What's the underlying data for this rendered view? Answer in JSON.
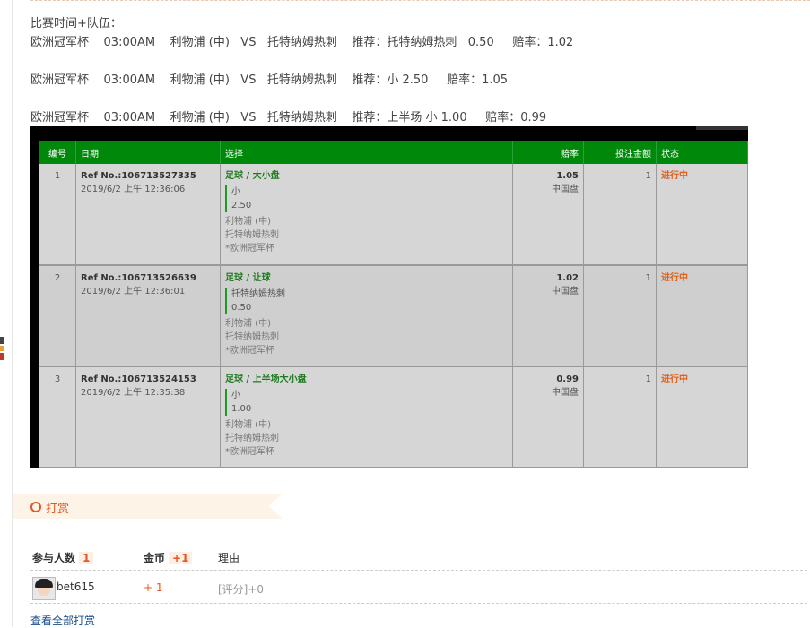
{
  "post": {
    "heading": "比赛时间+队伍：",
    "lines": [
      "欧洲冠军杯    03:00AM    利物浦 (中)   VS   托特纳姆热刺    推荐：托特纳姆热刺   0.50     赔率：1.02",
      "欧洲冠军杯    03:00AM    利物浦 (中)   VS   托特纳姆热刺    推荐：小 2.50     赔率：1.05",
      "欧洲冠军杯    03:00AM    利物浦 (中)   VS   托特纳姆热刺    推荐：上半场 小 1.00     赔率：0.99"
    ]
  },
  "bet_table": {
    "headers": {
      "no": "编号",
      "date": "日期",
      "selection": "选择",
      "odds": "赔率",
      "amount": "投注金额",
      "status": "状态"
    },
    "rows": [
      {
        "no": "1",
        "ref": "Ref No.:106713527335",
        "datetime": "2019/6/2 上午 12:36:06",
        "type": "足球 / 大小盘",
        "pick": "小",
        "line": "2.50",
        "home": "利物浦 (中)",
        "away": "托特纳姆热刺",
        "league": "*欧洲冠军杯",
        "odds": "1.05",
        "odds_type": "中国盘",
        "amount": "1",
        "status": "进行中"
      },
      {
        "no": "2",
        "ref": "Ref No.:106713526639",
        "datetime": "2019/6/2 上午 12:36:01",
        "type": "足球 / 让球",
        "pick": "托特纳姆热刺",
        "line": "0.50",
        "home": "利物浦 (中)",
        "away": "托特纳姆热刺",
        "league": "*欧洲冠军杯",
        "odds": "1.02",
        "odds_type": "中国盘",
        "amount": "1",
        "status": "进行中"
      },
      {
        "no": "3",
        "ref": "Ref No.:106713524153",
        "datetime": "2019/6/2 上午 12:35:38",
        "type": "足球 / 上半场大小盘",
        "pick": "小",
        "line": "1.00",
        "home": "利物浦 (中)",
        "away": "托特纳姆热刺",
        "league": "*欧洲冠军杯",
        "odds": "0.99",
        "odds_type": "中国盘",
        "amount": "1",
        "status": "进行中"
      }
    ]
  },
  "reward": {
    "title": "打赏",
    "participants_label": "参与人数",
    "participants_count": "1",
    "coins_label": "金币",
    "coins_total": "+1",
    "reason_label": "理由",
    "entries": [
      {
        "user": "bet615",
        "coins": "+ 1",
        "reason": "[评分]+0"
      }
    ],
    "view_all": "查看全部打赏"
  },
  "colors": {
    "table_header": "#00880a",
    "status_orange": "#e0601a",
    "accent": "#e25822",
    "link": "#1a4e8a"
  }
}
